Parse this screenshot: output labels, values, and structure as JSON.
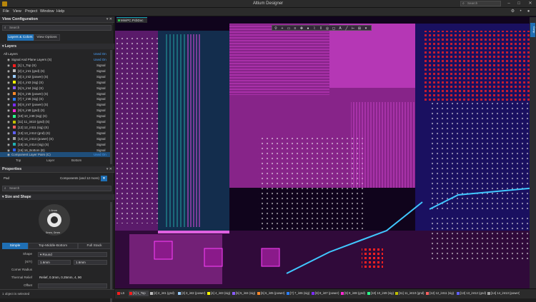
{
  "app": {
    "title": "Altium Designer"
  },
  "search": {
    "placeholder": "Search"
  },
  "menu": [
    {
      "label": "File"
    },
    {
      "label": "View"
    },
    {
      "label": "Project"
    },
    {
      "label": "Window"
    },
    {
      "label": "Help"
    }
  ],
  "view_config": {
    "title": "View Configuration",
    "search_placeholder": "Search",
    "tabs": [
      {
        "label": "Layers & Colors"
      },
      {
        "label": "View Options"
      }
    ],
    "layers_header": "Layers",
    "all_layers": {
      "label": "All Layers",
      "used": "Used On"
    },
    "signal_group": {
      "label": "Signal And Plane Layers (S)",
      "used": "Used On"
    },
    "layers": [
      {
        "name": "[1] 1_Top (S)",
        "type": "Signal",
        "color": "#ff1c1c"
      },
      {
        "name": "[2] 2_int1 (gnd) (S)",
        "type": "Signal",
        "color": "#bcbcbc"
      },
      {
        "name": "[3] 3_int2 (power) (S)",
        "type": "Signal",
        "color": "#99ccff"
      },
      {
        "name": "[4] 4_int3 (sig) (S)",
        "type": "Signal",
        "color": "#ffff00"
      },
      {
        "name": "[5] 5_int4 (sig) (S)",
        "type": "Signal",
        "color": "#8a5cff"
      },
      {
        "name": "[6] 6_int5 (power) (S)",
        "type": "Signal",
        "color": "#ff8a2a"
      },
      {
        "name": "[7] 7_int6 (sig) (S)",
        "type": "Signal",
        "color": "#2a7fff"
      },
      {
        "name": "[8] 8_int7 (power) (S)",
        "type": "Signal",
        "color": "#7b2aff"
      },
      {
        "name": "[9] 9_int8 (gnd) (S)",
        "type": "Signal",
        "color": "#ff2ad4"
      },
      {
        "name": "[10] 10_int9 (sig) (S)",
        "type": "Signal",
        "color": "#2aff8a"
      },
      {
        "name": "[11] 11_int10 (gnd) (S)",
        "type": "Signal",
        "color": "#c0c000"
      },
      {
        "name": "[12] 12_int11 (sig) (S)",
        "type": "Signal",
        "color": "#ff6060"
      },
      {
        "name": "[13] 13_int12 (gnd) (S)",
        "type": "Signal",
        "color": "#6060ff"
      },
      {
        "name": "[14] 14_int13 (power) (S)",
        "type": "Signal",
        "color": "#a0a0a0"
      },
      {
        "name": "[15] 15_int14 (sig) (S)",
        "type": "Signal",
        "color": "#20b0b0"
      },
      {
        "name": "[16] 16_Bottom (B)",
        "type": "Signal",
        "color": "#3060ff"
      }
    ],
    "component_pairs": {
      "label": "Component Layer Pairs (C)",
      "used": "Used On"
    },
    "sides": {
      "top": "Top",
      "layer": "Layer",
      "bottom": "Bottom"
    }
  },
  "properties": {
    "title": "Properties",
    "object": "Pad",
    "filter": "Components (and 12 more)",
    "search_placeholder": "Search",
    "size_shape_header": "Size and Shape",
    "pad_dims": {
      "width": "1.6mm",
      "offset": "0mm, 0mm"
    },
    "tabs": [
      {
        "label": "Simple"
      },
      {
        "label": "Top-Middle-Bottom"
      },
      {
        "label": "Full Stack"
      }
    ],
    "shape": {
      "label": "Shape",
      "value": "Round"
    },
    "xy": {
      "label": "(X/Y)",
      "x": "1.6mm",
      "y": "1.6mm"
    },
    "corner_radius": {
      "label": "Corner Radius",
      "value": ""
    },
    "thermal_relief": {
      "label": "Thermal Relief",
      "value": "Relief, 0.3mm, 0.25mm, 4, 90"
    },
    "offset": {
      "label": "Offset",
      "value": ""
    }
  },
  "status": {
    "text": "1 object is selected"
  },
  "document": {
    "tab": "MiniPC.PcbDoc"
  },
  "right_dock": {
    "label": "Comp"
  },
  "layer_tabs": [
    {
      "label": "LS",
      "color": "#ff1c1c"
    },
    {
      "label": "[1] 1_Top",
      "color": "#ff1c1c"
    },
    {
      "label": "[2] 2_int1 (gnd)",
      "color": "#bcbcbc"
    },
    {
      "label": "[3] 3_int2 (power)",
      "color": "#99ccff"
    },
    {
      "label": "[4] 4_int3 (sig)",
      "color": "#ffff00"
    },
    {
      "label": "[5] 5_int4 (sig)",
      "color": "#8a5cff"
    },
    {
      "label": "[6] 6_int5 (power)",
      "color": "#ff8a2a"
    },
    {
      "label": "[7] 7_int6 (sig)",
      "color": "#2a7fff"
    },
    {
      "label": "[8] 8_int7 (power)",
      "color": "#7b2aff"
    },
    {
      "label": "[9] 9_int8 (gnd)",
      "color": "#ff2ad4"
    },
    {
      "label": "[10] 10_int9 (sig)",
      "color": "#2aff8a"
    },
    {
      "label": "[11] 11_int10 (gnd)",
      "color": "#c0c000"
    },
    {
      "label": "[12] 12_int11 (sig)",
      "color": "#ff6060"
    },
    {
      "label": "[13] 13_int12 (gnd)",
      "color": "#6060ff"
    },
    {
      "label": "[14] 14_int13 (power)",
      "color": "#a0a0a0"
    }
  ]
}
